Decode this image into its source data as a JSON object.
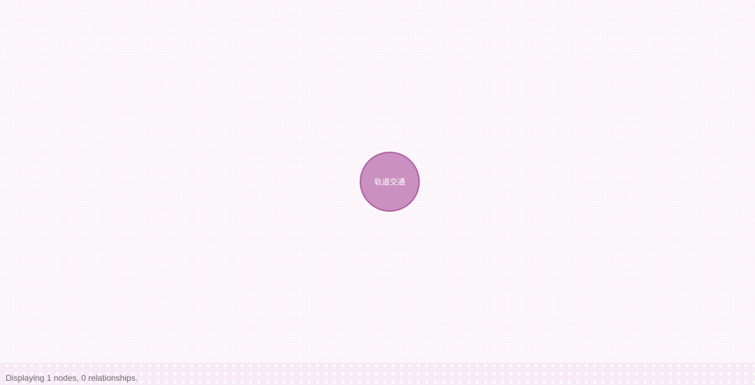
{
  "graph": {
    "nodes": [
      {
        "label": "轨道交通",
        "color": "#c990c0",
        "border_color": "#b261a5"
      }
    ]
  },
  "status_bar": {
    "text": "Displaying 1 nodes, 0 relationships."
  },
  "colors": {
    "canvas_background": "#fdf8fc",
    "status_bar_background": "#f8eaf6",
    "node_text": "#ffffff"
  }
}
